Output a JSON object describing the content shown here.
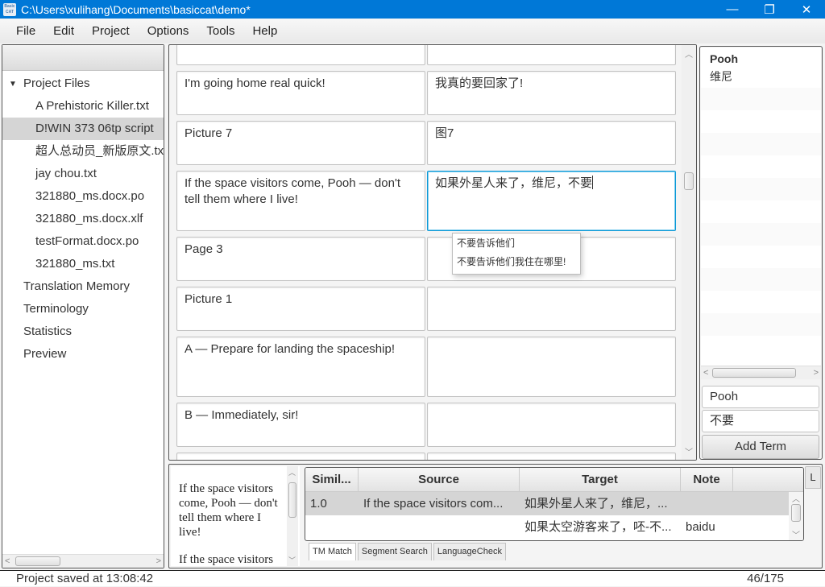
{
  "window": {
    "title": "C:\\Users\\xulihang\\Documents\\basiccat\\demo*",
    "app_icon_text": "Basic CAT",
    "controls": [
      "—",
      "❐",
      "✕"
    ]
  },
  "menu": [
    "File",
    "Edit",
    "Project",
    "Options",
    "Tools",
    "Help"
  ],
  "sidebar": {
    "root_label": "Project Files",
    "files": [
      "A Prehistoric Killer.txt",
      "D!WIN 373 06tp script",
      "超人总动员_新版原文.txt",
      "jay chou.txt",
      "321880_ms.docx.po",
      "321880_ms.docx.xlf",
      "testFormat.docx.po",
      "321880_ms.txt"
    ],
    "selected_file_index": 1,
    "sections": [
      "Translation Memory",
      "Terminology",
      "Statistics",
      "Preview"
    ]
  },
  "segments": [
    {
      "source": "",
      "target": ""
    },
    {
      "source": "I'm going home real quick!",
      "target": "我真的要回家了!"
    },
    {
      "source": "Picture 7",
      "target": "图7"
    },
    {
      "source": "If the space visitors come, Pooh — don't tell them where I live!",
      "target": "如果外星人来了，维尼，不要",
      "active": true
    },
    {
      "source": "Page 3",
      "target": ""
    },
    {
      "source": "Picture 1",
      "target": ""
    },
    {
      "source": "A — Prepare for landing the spaceship!",
      "target": ""
    },
    {
      "source": "B — Immediately, sir!",
      "target": ""
    },
    {
      "source": "",
      "target": ""
    }
  ],
  "autocomplete": [
    "不要告诉他们",
    "不要告诉他们我住在哪里!"
  ],
  "terminology": {
    "matches": [
      {
        "term": "Pooh",
        "translation": "维尼"
      }
    ],
    "source_input": "Pooh",
    "target_input": "不要",
    "add_button": "Add Term"
  },
  "preview_text": "If the space visitors come, Pooh — don't tell them where I live!",
  "preview_text_next": "If the space visitors",
  "tm_table": {
    "columns": [
      "Simil...",
      "Source",
      "Target",
      "Note"
    ],
    "rows": [
      {
        "similarity": "1.0",
        "source": "If the space visitors com...",
        "target": "如果外星人来了，维尼，...",
        "note": ""
      },
      {
        "similarity": "",
        "source": "",
        "target": "如果太空游客来了，呸-不...",
        "note": "baidu"
      }
    ]
  },
  "bottom_tabs": [
    "TM Match",
    "Segment Search",
    "LanguageCheck"
  ],
  "side_tab_label": "L",
  "status": {
    "message": "Project saved at 13:08:42",
    "position": "46/175"
  }
}
